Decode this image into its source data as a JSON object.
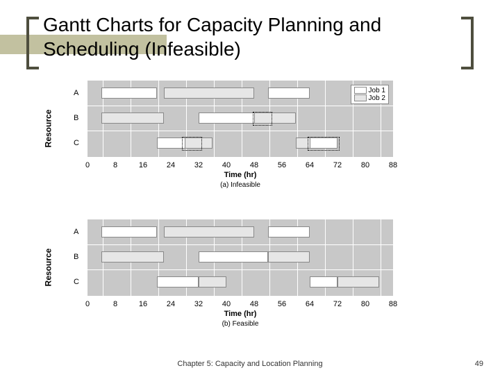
{
  "title": "Gantt Charts for Capacity Planning and Scheduling (Infeasible)",
  "footer_left": "Chapter 5: Capacity and Location Planning",
  "footer_right": "49",
  "legend": {
    "job1": "Job 1",
    "job2": "Job 2"
  },
  "common": {
    "xlabel": "Time (hr)",
    "ylabel": "Resource",
    "xticks": [
      0,
      8,
      16,
      24,
      32,
      40,
      48,
      56,
      64,
      72,
      80,
      88
    ],
    "resources": [
      "A",
      "B",
      "C"
    ],
    "x_range": [
      0,
      88
    ]
  },
  "subtitle_a": "(a) Infeasible",
  "subtitle_b": "(b) Feasible",
  "chart_data": [
    {
      "type": "bar",
      "title": "(a) Infeasible",
      "xlabel": "Time (hr)",
      "ylabel": "Resource",
      "categories": [
        "A",
        "B",
        "C"
      ],
      "xlim": [
        0,
        88
      ],
      "series": [
        {
          "name": "Job 1",
          "tasks": [
            {
              "resource": "A",
              "start": 4,
              "end": 20
            },
            {
              "resource": "C",
              "start": 20,
              "end": 32
            },
            {
              "resource": "B",
              "start": 32,
              "end": 52
            },
            {
              "resource": "A",
              "start": 52,
              "end": 64
            },
            {
              "resource": "C",
              "start": 64,
              "end": 72
            }
          ]
        },
        {
          "name": "Job 2",
          "tasks": [
            {
              "resource": "B",
              "start": 4,
              "end": 22
            },
            {
              "resource": "A",
              "start": 22,
              "end": 48
            },
            {
              "resource": "B",
              "start": 48,
              "end": 60
            },
            {
              "resource": "C",
              "start": 28,
              "end": 36
            },
            {
              "resource": "C",
              "start": 60,
              "end": 72
            }
          ]
        }
      ]
    },
    {
      "type": "bar",
      "title": "(b) Feasible",
      "xlabel": "Time (hr)",
      "ylabel": "Resource",
      "categories": [
        "A",
        "B",
        "C"
      ],
      "xlim": [
        0,
        88
      ],
      "series": [
        {
          "name": "Job 1",
          "tasks": [
            {
              "resource": "A",
              "start": 4,
              "end": 20
            },
            {
              "resource": "C",
              "start": 20,
              "end": 32
            },
            {
              "resource": "B",
              "start": 32,
              "end": 52
            },
            {
              "resource": "A",
              "start": 52,
              "end": 64
            },
            {
              "resource": "C",
              "start": 64,
              "end": 72
            }
          ]
        },
        {
          "name": "Job 2",
          "tasks": [
            {
              "resource": "B",
              "start": 4,
              "end": 22
            },
            {
              "resource": "A",
              "start": 22,
              "end": 48
            },
            {
              "resource": "C",
              "start": 32,
              "end": 40
            },
            {
              "resource": "B",
              "start": 52,
              "end": 64
            },
            {
              "resource": "C",
              "start": 72,
              "end": 84
            }
          ]
        }
      ]
    }
  ]
}
